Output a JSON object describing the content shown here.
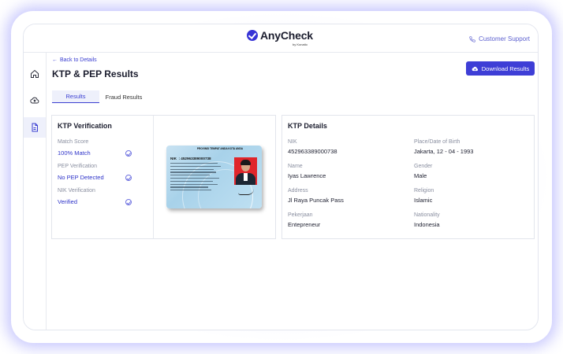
{
  "header": {
    "logo_text": "AnyCheck",
    "logo_sub": "by Konatio",
    "support_label": "Customer Support"
  },
  "sidebar": {
    "items": [
      {
        "icon": "home-icon"
      },
      {
        "icon": "cloud-upload-icon"
      },
      {
        "icon": "document-icon"
      }
    ]
  },
  "page": {
    "back_label": "Back to Details",
    "title": "KTP & PEP Results",
    "download_label": "Download Results"
  },
  "tabs": [
    {
      "label": "Results",
      "active": true
    },
    {
      "label": "Fraud Results",
      "active": false
    }
  ],
  "verification": {
    "title": "KTP Verification",
    "items": [
      {
        "label": "Match Score",
        "value": "100% Match"
      },
      {
        "label": "PEP Verification",
        "value": "No PEP Detected"
      },
      {
        "label": "NIK Verification",
        "value": "Verified"
      }
    ]
  },
  "id_card": {
    "header": "PROVINSI TEMPAT ANDA KOTA ANDA",
    "nik_label": "NIK",
    "nik_value": ": 452963389000738"
  },
  "details": {
    "title": "KTP Details",
    "fields": [
      {
        "label": "NIK",
        "value": "452963389000738"
      },
      {
        "label": "Place/Date of Birth",
        "value": "Jakarta, 12 - 04 - 1993"
      },
      {
        "label": "Name",
        "value": "Iyas Lawrence"
      },
      {
        "label": "Gender",
        "value": "Male"
      },
      {
        "label": "Address",
        "value": "Jl Raya Puncak Pass"
      },
      {
        "label": "Religion",
        "value": "Islamic"
      },
      {
        "label": "Pekerjaan",
        "value": "Entepreneur"
      },
      {
        "label": "Nationality",
        "value": "Indonesia"
      }
    ]
  },
  "colors": {
    "accent": "#3e3ed6",
    "link": "#3b3fd1",
    "muted": "#8a8fa0"
  }
}
